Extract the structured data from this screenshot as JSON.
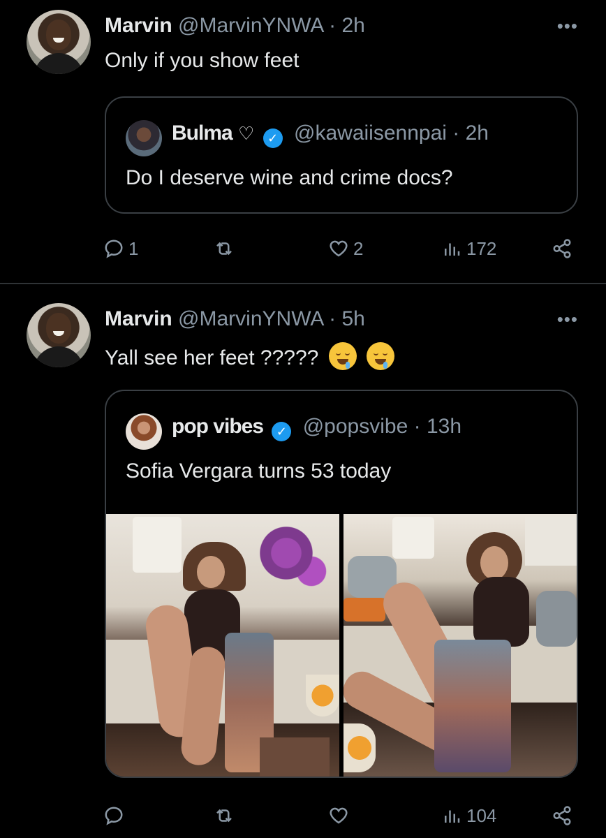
{
  "tweets": [
    {
      "author_name": "Marvin",
      "handle": "@MarvinYNWA",
      "time": "2h",
      "text": "Only if you show feet",
      "quote": {
        "author_name": "Bulma",
        "handle": "@kawaiisennpai",
        "time": "2h",
        "text": "Do I deserve wine and crime docs?"
      },
      "actions": {
        "replies": "1",
        "retweets": "",
        "likes": "2",
        "views": "172"
      }
    },
    {
      "author_name": "Marvin",
      "handle": "@MarvinYNWA",
      "time": "5h",
      "text": "Yall see her feet ?????",
      "quote": {
        "author_name": "pop vibes",
        "handle": "@popsvibe",
        "time": "13h",
        "text": "Sofia Vergara turns 53 today"
      },
      "actions": {
        "replies": "",
        "retweets": "",
        "likes": "",
        "views": "104"
      }
    }
  ],
  "separator": "·",
  "colors": {
    "background": "#000000",
    "text": "#e7e9ea",
    "secondary": "#8b98a5",
    "verified": "#1d9bf0",
    "border": "#3a3f44"
  },
  "icons": [
    "reply-icon",
    "retweet-icon",
    "like-icon",
    "views-icon",
    "share-icon",
    "more-icon",
    "verified-badge-icon",
    "drooling-face-emoji"
  ]
}
